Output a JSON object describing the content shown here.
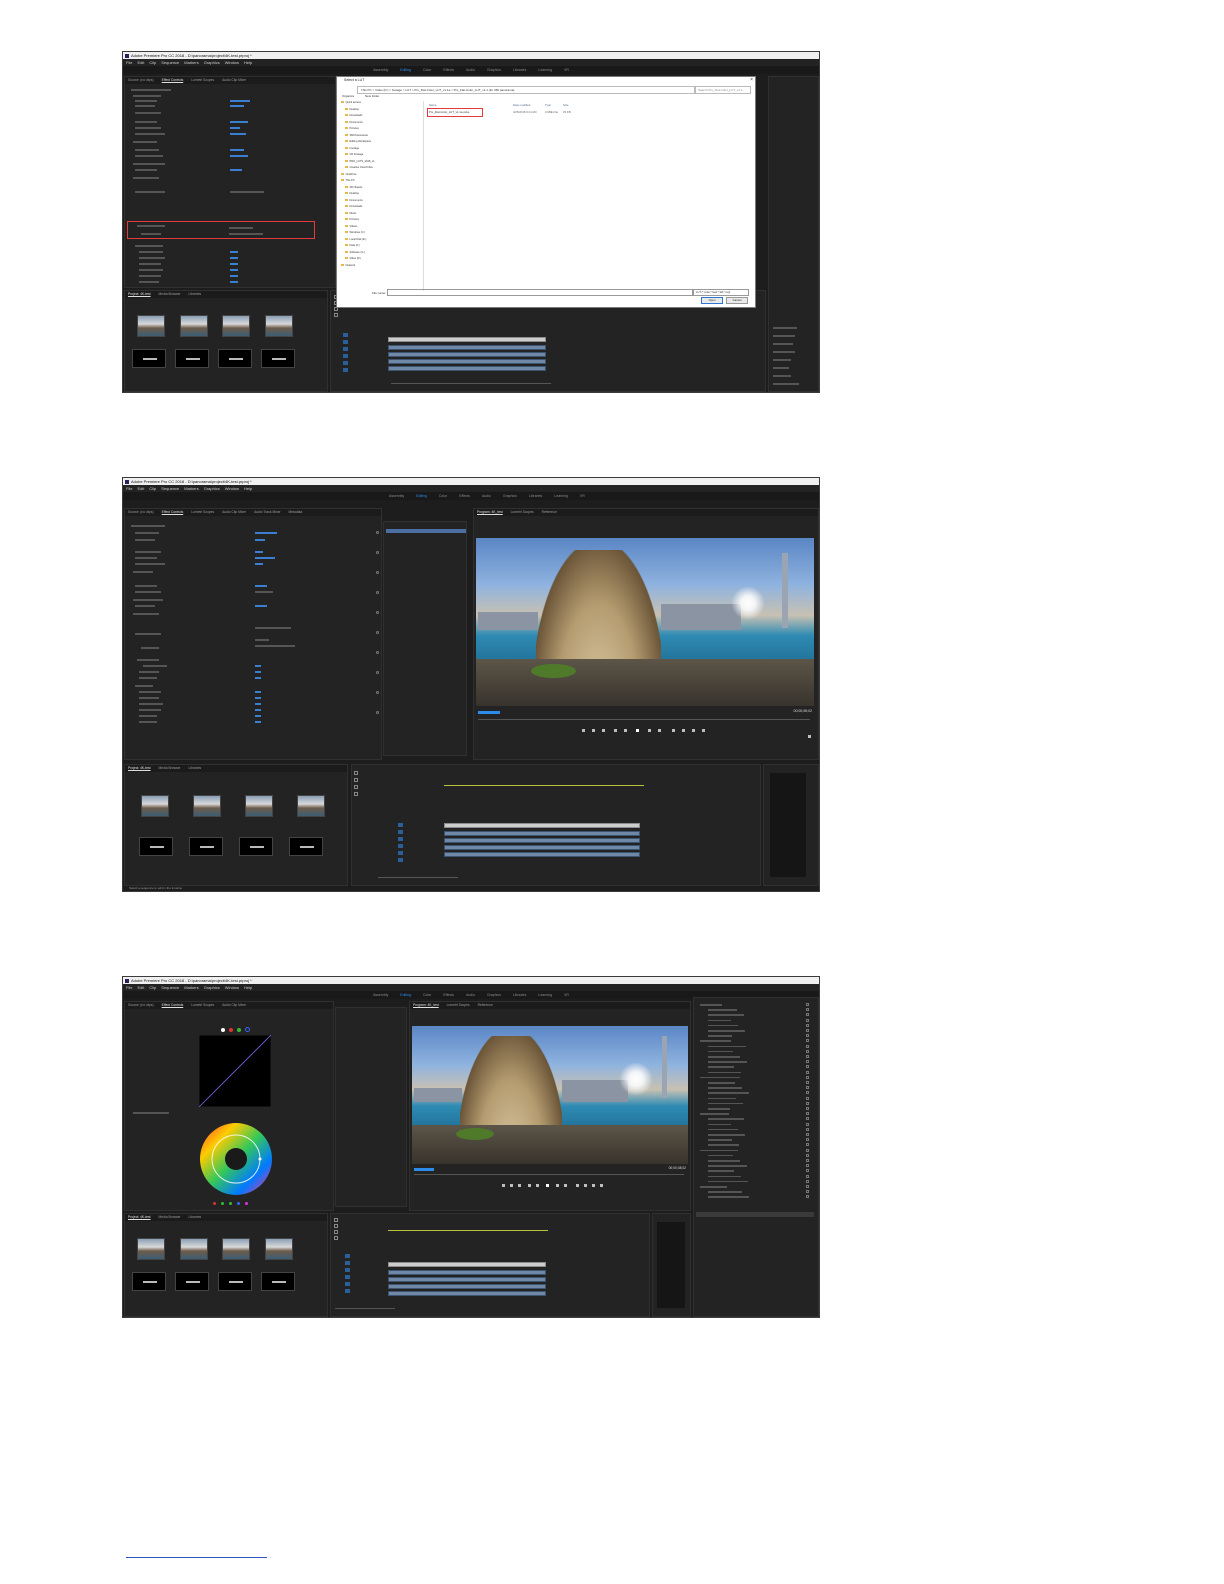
{
  "screenshots": [
    {
      "window_title": "Adobe Premiere Pro CC 2018 - D:\\panorama\\project\\4K-test.prproj *",
      "menu": [
        "File",
        "Edit",
        "Clip",
        "Sequence",
        "Markers",
        "Graphics",
        "Window",
        "Help"
      ],
      "workspaces": [
        "Assembly",
        "Editing",
        "Color",
        "Effects",
        "Audio",
        "Graphics",
        "Libraries",
        "Learning",
        "VR"
      ],
      "active_workspace": "Editing",
      "panel_tabs": [
        "Source: (no clips)",
        "Effect Controls",
        "Lumetri Scopes",
        "Audio Clip Mixer",
        "Audio Track Mixer",
        "Metadata"
      ],
      "project_tabs": [
        "Project: 4K-test",
        "Media Browser",
        "Libraries"
      ],
      "dialog": {
        "title": "Select a LUT",
        "address": "This PC  >  Video (D:)  >  footage  >  LUT  >  Pro_Flat-Color_LUT_v1.1a  >  Pro_Flat-Color_LUT_v1.1 (for 360 panorama)",
        "search_placeholder": "Search Pro_Flat-Color_LUT_v1.1...",
        "toolbar": [
          "Organize",
          "New folder"
        ],
        "columns": [
          "Name",
          "Date modified",
          "Type",
          "Size"
        ],
        "nav_items": [
          "Quick access",
          "Desktop",
          "Downloads",
          "Documents",
          "Pictures",
          "360 Panoramas",
          "Editing Workspace",
          "Footage",
          "VR Footage",
          "PRO_LUTS_2018_v1",
          "Creative Cloud Files",
          "OneDrive",
          "This PC",
          "3D Objects",
          "Desktop",
          "Documents",
          "Downloads",
          "Music",
          "Pictures",
          "Videos",
          "Windows (C:)",
          "Local Disk (E:)",
          "Data (F:)",
          "Software (G:)",
          "Video (D:)",
          "Network"
        ],
        "file": {
          "name": "Pro_Flat-Color_LUT_v1.1a.cube",
          "date": "4/25/2018 9:14 AM",
          "type": "CUBE File",
          "size": "33 KB"
        },
        "filename_label": "File name:",
        "filetype": "LUT (*.cube;*.look;*.3dl;*.csp)",
        "open_label": "Open",
        "cancel_label": "Cancel"
      }
    },
    {
      "window_title": "Adobe Premiere Pro CC 2018 - D:\\panorama\\project\\4K-test.prproj *",
      "menu": [
        "File",
        "Edit",
        "Clip",
        "Sequence",
        "Markers",
        "Graphics",
        "Window",
        "Help"
      ],
      "workspaces": [
        "Assembly",
        "Editing",
        "Color",
        "Effects",
        "Audio",
        "Graphics",
        "Libraries",
        "Learning",
        "VR"
      ],
      "active_workspace": "Editing",
      "panel_tabs": [
        "Source: (no clips)",
        "Effect Controls",
        "Lumetri Scopes",
        "Audio Clip Mixer",
        "Audio Track Mixer",
        "Metadata"
      ],
      "program_tabs": [
        "Program: 4K_test",
        "Lumetri Scopes",
        "Reference"
      ],
      "project_tabs": [
        "Project: 4K-test",
        "Media Browser",
        "Libraries"
      ],
      "timecode_current": "00;00;00;00",
      "timecode_end": "00;00;08;02",
      "status_text": "Select a sequence to edit in the timeline"
    },
    {
      "window_title": "Adobe Premiere Pro CC 2018 - D:\\panorama\\project\\4K-test.prproj *",
      "menu": [
        "File",
        "Edit",
        "Clip",
        "Sequence",
        "Markers",
        "Graphics",
        "Window",
        "Help"
      ],
      "workspaces": [
        "Assembly",
        "Editing",
        "Color",
        "Effects",
        "Audio",
        "Graphics",
        "Libraries",
        "Learning",
        "VR"
      ],
      "active_workspace": "Editing",
      "panel_tabs": [
        "Source: (no clips)",
        "Effect Controls",
        "Lumetri Scopes",
        "Audio Clip Mixer",
        "Audio Track Mixer",
        "Metadata"
      ],
      "program_tabs": [
        "Program: 4K_test",
        "Lumetri Scopes",
        "Reference"
      ],
      "project_tabs": [
        "Project: 4K-test",
        "Media Browser",
        "Libraries"
      ],
      "timecode_current": "00;00;00;00",
      "timecode_end": "00;00;08;02"
    }
  ],
  "colors": {
    "accent": "#2d8ceb",
    "panel_bg": "#232323",
    "app_bg": "#1d1d1d",
    "highlight_box": "#e23b3b"
  }
}
